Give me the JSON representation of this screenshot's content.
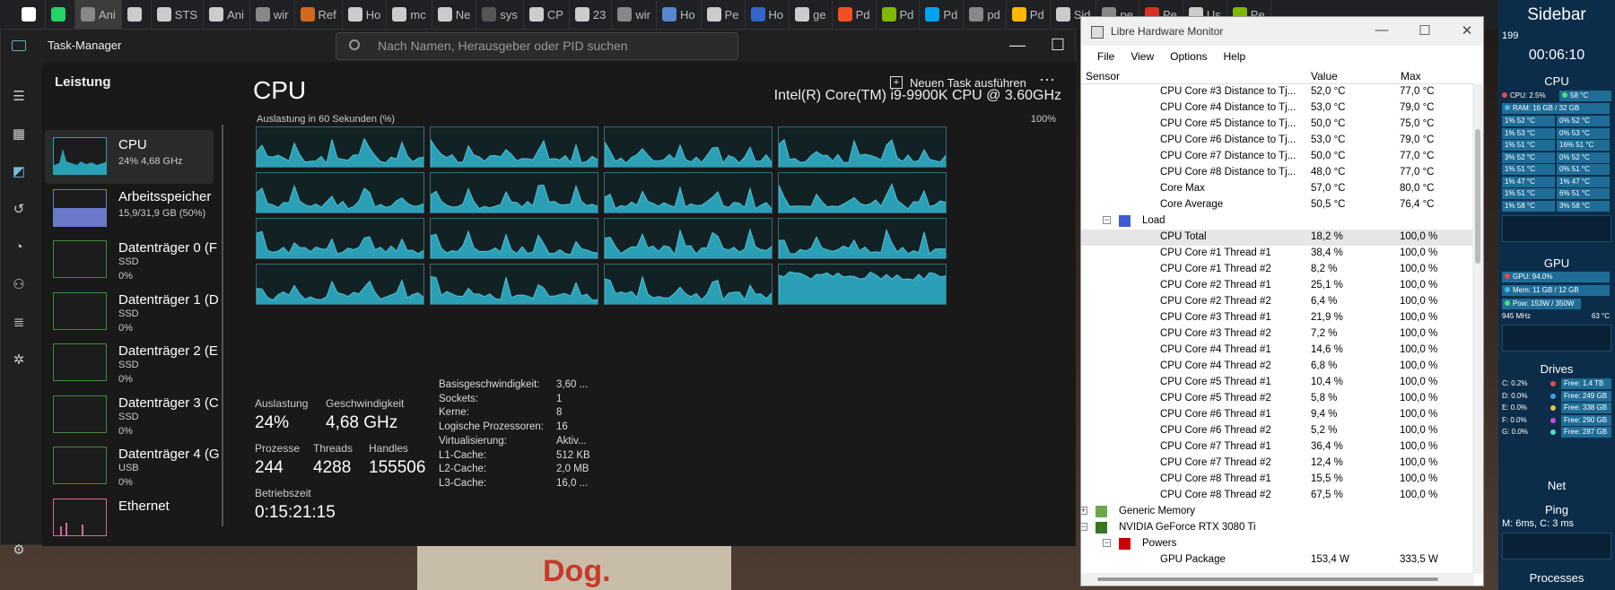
{
  "browser_tabs": [
    {
      "label": "",
      "color": "#ffffff"
    },
    {
      "label": "",
      "color": "#25d366"
    },
    {
      "label": "Ani",
      "color": "#888888"
    },
    {
      "label": "",
      "color": "#cccccc"
    },
    {
      "label": "STS",
      "color": "#cccccc"
    },
    {
      "label": "Ani",
      "color": "#cccccc"
    },
    {
      "label": "wir",
      "color": "#888888"
    },
    {
      "label": "Ref",
      "color": "#d2691e"
    },
    {
      "label": "Ho",
      "color": "#cccccc"
    },
    {
      "label": "mc",
      "color": "#cccccc"
    },
    {
      "label": "Ne",
      "color": "#cccccc"
    },
    {
      "label": "sys",
      "color": "#555555"
    },
    {
      "label": "CP",
      "color": "#cccccc"
    },
    {
      "label": "23",
      "color": "#cccccc"
    },
    {
      "label": "wir",
      "color": "#888888"
    },
    {
      "label": "Ho",
      "color": "#5588cc"
    },
    {
      "label": "Pe",
      "color": "#cccccc"
    },
    {
      "label": "Ho",
      "color": "#3366cc"
    },
    {
      "label": "ge",
      "color": "#cccccc"
    },
    {
      "label": "Pd",
      "color": "#f25022"
    },
    {
      "label": "Pd",
      "color": "#7fba00"
    },
    {
      "label": "Pd",
      "color": "#00a4ef"
    },
    {
      "label": "pd",
      "color": "#888888"
    },
    {
      "label": "Pd",
      "color": "#ffb900"
    },
    {
      "label": "Sid",
      "color": "#cccccc"
    },
    {
      "label": "pe",
      "color": "#888888"
    },
    {
      "label": "Pe",
      "color": "#d93025"
    },
    {
      "label": "Us",
      "color": "#cccccc"
    },
    {
      "label": "Pe",
      "color": "#7fba00"
    }
  ],
  "task_manager": {
    "title": "Task-Manager",
    "search_placeholder": "Nach Namen, Herausgeber oder PID suchen",
    "section": "Leistung",
    "run_task_label": "Neuen Task ausführen",
    "more_icon": "⋯",
    "tiles": [
      {
        "name": "CPU",
        "sub": "24% 4,68 GHz",
        "sub2": ""
      },
      {
        "name": "Arbeitsspeicher",
        "sub": "15,9/31,9 GB (50%)",
        "sub2": ""
      },
      {
        "name": "Datenträger 0 (F",
        "sub": "SSD",
        "sub2": "0%"
      },
      {
        "name": "Datenträger 1 (D",
        "sub": "SSD",
        "sub2": "0%"
      },
      {
        "name": "Datenträger 2 (E",
        "sub": "SSD",
        "sub2": "0%"
      },
      {
        "name": "Datenträger 3 (C",
        "sub": "SSD",
        "sub2": "0%"
      },
      {
        "name": "Datenträger 4 (G",
        "sub": "USB",
        "sub2": "0%"
      },
      {
        "name": "Ethernet",
        "sub": "",
        "sub2": ""
      }
    ],
    "cpu": {
      "heading": "CPU",
      "model": "Intel(R) Core(TM) i9-9900K CPU @ 3.60GHz",
      "util_label": "Auslastung in 60 Sekunden (%)",
      "util_max": "100%",
      "stats": {
        "auslastung_label": "Auslastung",
        "auslastung": "24%",
        "speed_label": "Geschwindigkeit",
        "speed": "4,68 GHz",
        "prozesse_label": "Prozesse",
        "prozesse": "244",
        "threads_label": "Threads",
        "threads": "4288",
        "handles_label": "Handles",
        "handles": "155506",
        "uptime_label": "Betriebszeit",
        "uptime": "0:15:21:15"
      },
      "specs": [
        {
          "k": "Basisgeschwindigkeit:",
          "v": "3,60 ..."
        },
        {
          "k": "Sockets:",
          "v": "1"
        },
        {
          "k": "Kerne:",
          "v": "8"
        },
        {
          "k": "Logische Prozessoren:",
          "v": "16"
        },
        {
          "k": "Virtualisierung:",
          "v": "Aktiv..."
        },
        {
          "k": "L1-Cache:",
          "v": "512 KB"
        },
        {
          "k": "L2-Cache:",
          "v": "2,0 MB"
        },
        {
          "k": "L3-Cache:",
          "v": "16,0 ..."
        }
      ]
    }
  },
  "lhm": {
    "title": "Libre Hardware Monitor",
    "menu": [
      "File",
      "View",
      "Options",
      "Help"
    ],
    "columns": [
      "Sensor",
      "Value",
      "Max"
    ],
    "rows": [
      {
        "indent": 4,
        "name": "CPU Core #3 Distance to Tj...",
        "value": "52,0 °C",
        "max": "77,0 °C"
      },
      {
        "indent": 4,
        "name": "CPU Core #4 Distance to Tj...",
        "value": "53,0 °C",
        "max": "79,0 °C"
      },
      {
        "indent": 4,
        "name": "CPU Core #5 Distance to Tj...",
        "value": "50,0 °C",
        "max": "75,0 °C"
      },
      {
        "indent": 4,
        "name": "CPU Core #6 Distance to Tj...",
        "value": "53,0 °C",
        "max": "79,0 °C"
      },
      {
        "indent": 4,
        "name": "CPU Core #7 Distance to Tj...",
        "value": "50,0 °C",
        "max": "77,0 °C"
      },
      {
        "indent": 4,
        "name": "CPU Core #8 Distance to Tj...",
        "value": "48,0 °C",
        "max": "77,0 °C"
      },
      {
        "indent": 4,
        "name": "Core Max",
        "value": "57,0 °C",
        "max": "80,0 °C"
      },
      {
        "indent": 4,
        "name": "Core Average",
        "value": "50,5 °C",
        "max": "76,4 °C"
      },
      {
        "indent": 2,
        "name": "Load",
        "value": "",
        "max": "",
        "node": "load"
      },
      {
        "indent": 4,
        "name": "CPU Total",
        "value": "18,2 %",
        "max": "100,0 %",
        "hl": true
      },
      {
        "indent": 4,
        "name": "CPU Core #1 Thread #1",
        "value": "38,4 %",
        "max": "100,0 %"
      },
      {
        "indent": 4,
        "name": "CPU Core #1 Thread #2",
        "value": "8,2 %",
        "max": "100,0 %"
      },
      {
        "indent": 4,
        "name": "CPU Core #2 Thread #1",
        "value": "25,1 %",
        "max": "100,0 %"
      },
      {
        "indent": 4,
        "name": "CPU Core #2 Thread #2",
        "value": "6,4 %",
        "max": "100,0 %"
      },
      {
        "indent": 4,
        "name": "CPU Core #3 Thread #1",
        "value": "21,9 %",
        "max": "100,0 %"
      },
      {
        "indent": 4,
        "name": "CPU Core #3 Thread #2",
        "value": "7,2 %",
        "max": "100,0 %"
      },
      {
        "indent": 4,
        "name": "CPU Core #4 Thread #1",
        "value": "14,6 %",
        "max": "100,0 %"
      },
      {
        "indent": 4,
        "name": "CPU Core #4 Thread #2",
        "value": "6,8 %",
        "max": "100,0 %"
      },
      {
        "indent": 4,
        "name": "CPU Core #5 Thread #1",
        "value": "10,4 %",
        "max": "100,0 %"
      },
      {
        "indent": 4,
        "name": "CPU Core #5 Thread #2",
        "value": "5,8 %",
        "max": "100,0 %"
      },
      {
        "indent": 4,
        "name": "CPU Core #6 Thread #1",
        "value": "9,4 %",
        "max": "100,0 %"
      },
      {
        "indent": 4,
        "name": "CPU Core #6 Thread #2",
        "value": "5,2 %",
        "max": "100,0 %"
      },
      {
        "indent": 4,
        "name": "CPU Core #7 Thread #1",
        "value": "36,4 %",
        "max": "100,0 %"
      },
      {
        "indent": 4,
        "name": "CPU Core #7 Thread #2",
        "value": "12,4 %",
        "max": "100,0 %"
      },
      {
        "indent": 4,
        "name": "CPU Core #8 Thread #1",
        "value": "15,5 %",
        "max": "100,0 %"
      },
      {
        "indent": 4,
        "name": "CPU Core #8 Thread #2",
        "value": "67,5 %",
        "max": "100,0 %"
      },
      {
        "indent": 1,
        "name": "Generic Memory",
        "value": "",
        "max": "",
        "node": "mem",
        "collapsed": true
      },
      {
        "indent": 1,
        "name": "NVIDIA GeForce RTX 3080 Ti",
        "value": "",
        "max": "",
        "node": "gpu"
      },
      {
        "indent": 2,
        "name": "Powers",
        "value": "",
        "max": "",
        "node": "power"
      },
      {
        "indent": 4,
        "name": "GPU Package",
        "value": "153,4 W",
        "max": "333,5 W"
      }
    ]
  },
  "sidebar": {
    "title": "Sidebar",
    "date": "199",
    "time": "00:06:10",
    "cpu_title": "CPU",
    "cpu_load": "CPU: 2.5%",
    "cpu_temp": "58 °C",
    "ram": "RAM: 16 GB / 32 GB",
    "cores": [
      [
        "1% 52 °C",
        "0% 52 °C"
      ],
      [
        "1% 53 °C",
        "0% 53 °C"
      ],
      [
        "1% 51 °C",
        "16% 51 °C"
      ],
      [
        "3% 52 °C",
        "0% 52 °C"
      ],
      [
        "1% 51 °C",
        "0% 51 °C"
      ],
      [
        "1% 47 °C",
        "1% 47 °C"
      ],
      [
        "1% 51 °C",
        "6% 51 °C"
      ],
      [
        "1% 58 °C",
        "3% 58 °C"
      ]
    ],
    "gpu_title": "GPU",
    "gpu_load": "GPU: 94.0%",
    "gpu_mem": "Mem: 11 GB / 12 GB",
    "gpu_pow": "Pow: 153W / 350W",
    "gpu_clock": "945 MHz",
    "gpu_temp": "63 °C",
    "drives_title": "Drives",
    "drives": [
      {
        "load": "C: 0.2%",
        "free": "Free: 1.4 TB",
        "color": "#e24b4b"
      },
      {
        "load": "D: 0.0%",
        "free": "Free: 249 GB",
        "color": "#4b9be2"
      },
      {
        "load": "E: 0.0%",
        "free": "Free: 338 GB",
        "color": "#e2c84b"
      },
      {
        "load": "F: 0.0%",
        "free": "Free: 290 GB",
        "color": "#c24be2"
      },
      {
        "load": "G: 0.0%",
        "free": "Free: 287 GB",
        "color": "#4be2c8"
      }
    ],
    "net_title": "Net",
    "ping_title": "Ping",
    "ping": "M: 6ms, C: 3 ms",
    "processes_title": "Processes"
  },
  "colors": {
    "accent": "#2b9fb5",
    "sidebar_bg": "#0c2d49"
  }
}
